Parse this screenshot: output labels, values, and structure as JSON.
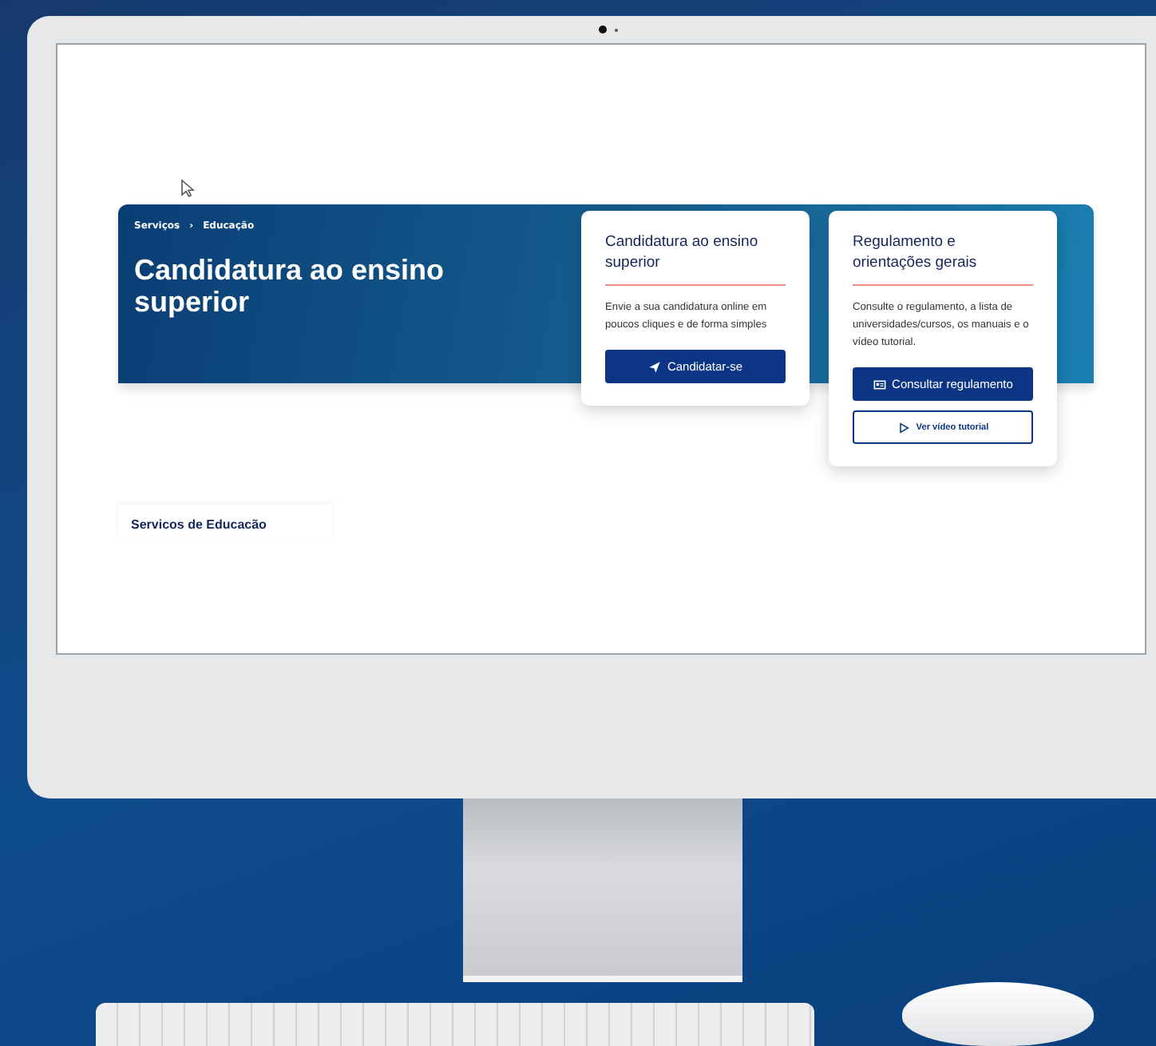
{
  "breadcrumb": [
    {
      "label": "Serviços"
    },
    {
      "label": "›"
    },
    {
      "label": "Educação"
    }
  ],
  "hero": {
    "title": "Candidatura ao ensino superior"
  },
  "cards": [
    {
      "title": "Candidatura ao ensino superior",
      "description": "Envie a sua candidatura online em poucos cliques e de forma simples",
      "buttons": [
        {
          "label": "Candidatar-se",
          "kind": "send"
        }
      ]
    },
    {
      "title": "Regulamento e orientações gerais",
      "description": "Consulte o regulamento, a lista de universidades/cursos, os manuais e o vídeo tutorial.",
      "buttons": [
        {
          "label": "Consultar regulamento",
          "kind": "document"
        },
        {
          "label": "Ver vídeo tutorial",
          "kind": "video"
        }
      ]
    }
  ],
  "section": {
    "title": "Servicos de Educacão"
  }
}
